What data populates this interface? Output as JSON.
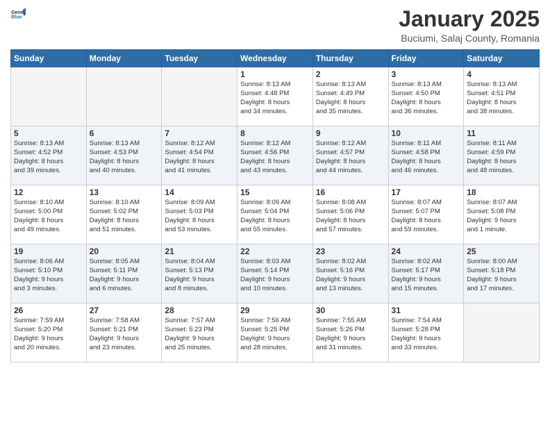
{
  "header": {
    "logo_general": "General",
    "logo_blue": "Blue",
    "title": "January 2025",
    "subtitle": "Buciumi, Salaj County, Romania"
  },
  "weekdays": [
    "Sunday",
    "Monday",
    "Tuesday",
    "Wednesday",
    "Thursday",
    "Friday",
    "Saturday"
  ],
  "weeks": [
    [
      {
        "day": "",
        "info": ""
      },
      {
        "day": "",
        "info": ""
      },
      {
        "day": "",
        "info": ""
      },
      {
        "day": "1",
        "info": "Sunrise: 8:13 AM\nSunset: 4:48 PM\nDaylight: 8 hours\nand 34 minutes."
      },
      {
        "day": "2",
        "info": "Sunrise: 8:13 AM\nSunset: 4:49 PM\nDaylight: 8 hours\nand 35 minutes."
      },
      {
        "day": "3",
        "info": "Sunrise: 8:13 AM\nSunset: 4:50 PM\nDaylight: 8 hours\nand 36 minutes."
      },
      {
        "day": "4",
        "info": "Sunrise: 8:13 AM\nSunset: 4:51 PM\nDaylight: 8 hours\nand 38 minutes."
      }
    ],
    [
      {
        "day": "5",
        "info": "Sunrise: 8:13 AM\nSunset: 4:52 PM\nDaylight: 8 hours\nand 39 minutes."
      },
      {
        "day": "6",
        "info": "Sunrise: 8:13 AM\nSunset: 4:53 PM\nDaylight: 8 hours\nand 40 minutes."
      },
      {
        "day": "7",
        "info": "Sunrise: 8:12 AM\nSunset: 4:54 PM\nDaylight: 8 hours\nand 41 minutes."
      },
      {
        "day": "8",
        "info": "Sunrise: 8:12 AM\nSunset: 4:56 PM\nDaylight: 8 hours\nand 43 minutes."
      },
      {
        "day": "9",
        "info": "Sunrise: 8:12 AM\nSunset: 4:57 PM\nDaylight: 8 hours\nand 44 minutes."
      },
      {
        "day": "10",
        "info": "Sunrise: 8:11 AM\nSunset: 4:58 PM\nDaylight: 8 hours\nand 46 minutes."
      },
      {
        "day": "11",
        "info": "Sunrise: 8:11 AM\nSunset: 4:59 PM\nDaylight: 8 hours\nand 48 minutes."
      }
    ],
    [
      {
        "day": "12",
        "info": "Sunrise: 8:10 AM\nSunset: 5:00 PM\nDaylight: 8 hours\nand 49 minutes."
      },
      {
        "day": "13",
        "info": "Sunrise: 8:10 AM\nSunset: 5:02 PM\nDaylight: 8 hours\nand 51 minutes."
      },
      {
        "day": "14",
        "info": "Sunrise: 8:09 AM\nSunset: 5:03 PM\nDaylight: 8 hours\nand 53 minutes."
      },
      {
        "day": "15",
        "info": "Sunrise: 8:09 AM\nSunset: 5:04 PM\nDaylight: 8 hours\nand 55 minutes."
      },
      {
        "day": "16",
        "info": "Sunrise: 8:08 AM\nSunset: 5:06 PM\nDaylight: 8 hours\nand 57 minutes."
      },
      {
        "day": "17",
        "info": "Sunrise: 8:07 AM\nSunset: 5:07 PM\nDaylight: 8 hours\nand 59 minutes."
      },
      {
        "day": "18",
        "info": "Sunrise: 8:07 AM\nSunset: 5:08 PM\nDaylight: 9 hours\nand 1 minute."
      }
    ],
    [
      {
        "day": "19",
        "info": "Sunrise: 8:06 AM\nSunset: 5:10 PM\nDaylight: 9 hours\nand 3 minutes."
      },
      {
        "day": "20",
        "info": "Sunrise: 8:05 AM\nSunset: 5:11 PM\nDaylight: 9 hours\nand 6 minutes."
      },
      {
        "day": "21",
        "info": "Sunrise: 8:04 AM\nSunset: 5:13 PM\nDaylight: 9 hours\nand 8 minutes."
      },
      {
        "day": "22",
        "info": "Sunrise: 8:03 AM\nSunset: 5:14 PM\nDaylight: 9 hours\nand 10 minutes."
      },
      {
        "day": "23",
        "info": "Sunrise: 8:02 AM\nSunset: 5:16 PM\nDaylight: 9 hours\nand 13 minutes."
      },
      {
        "day": "24",
        "info": "Sunrise: 8:02 AM\nSunset: 5:17 PM\nDaylight: 9 hours\nand 15 minutes."
      },
      {
        "day": "25",
        "info": "Sunrise: 8:00 AM\nSunset: 5:18 PM\nDaylight: 9 hours\nand 17 minutes."
      }
    ],
    [
      {
        "day": "26",
        "info": "Sunrise: 7:59 AM\nSunset: 5:20 PM\nDaylight: 9 hours\nand 20 minutes."
      },
      {
        "day": "27",
        "info": "Sunrise: 7:58 AM\nSunset: 5:21 PM\nDaylight: 9 hours\nand 23 minutes."
      },
      {
        "day": "28",
        "info": "Sunrise: 7:57 AM\nSunset: 5:23 PM\nDaylight: 9 hours\nand 25 minutes."
      },
      {
        "day": "29",
        "info": "Sunrise: 7:56 AM\nSunset: 5:25 PM\nDaylight: 9 hours\nand 28 minutes."
      },
      {
        "day": "30",
        "info": "Sunrise: 7:55 AM\nSunset: 5:26 PM\nDaylight: 9 hours\nand 31 minutes."
      },
      {
        "day": "31",
        "info": "Sunrise: 7:54 AM\nSunset: 5:28 PM\nDaylight: 9 hours\nand 33 minutes."
      },
      {
        "day": "",
        "info": ""
      }
    ]
  ]
}
